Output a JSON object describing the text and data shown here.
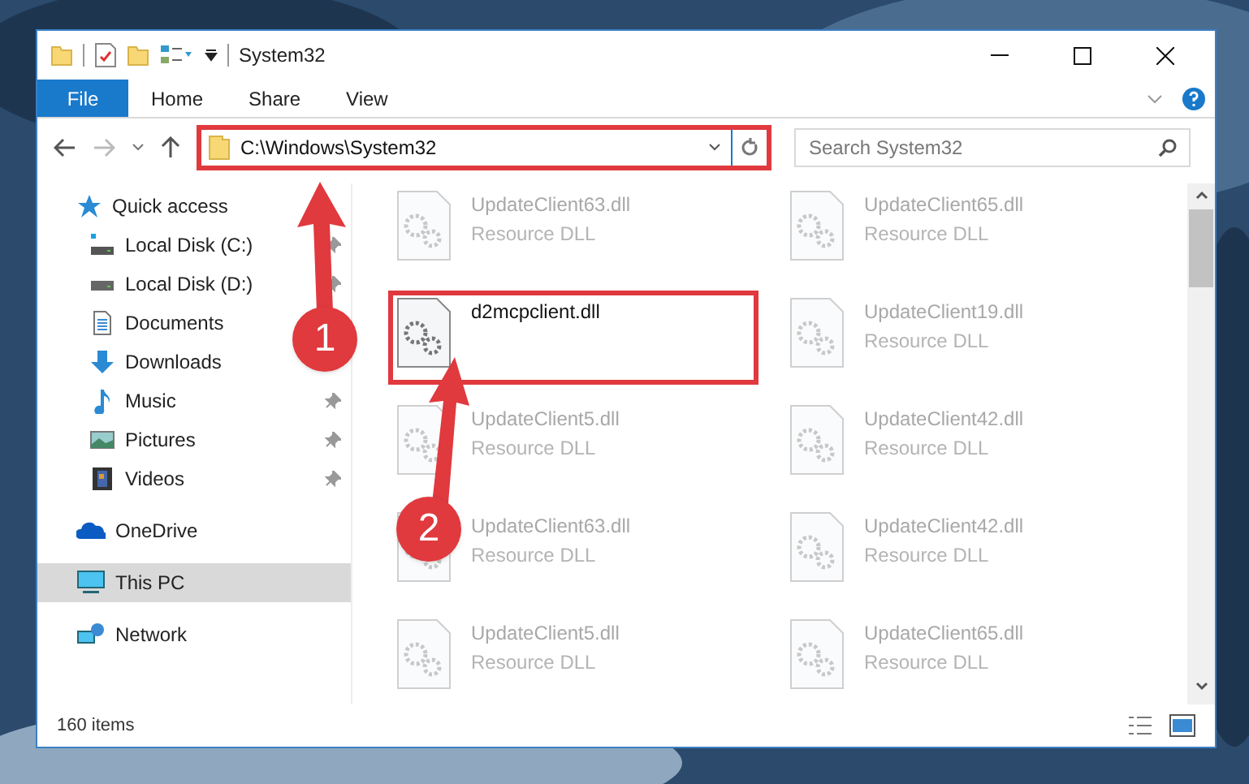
{
  "window": {
    "title": "System32"
  },
  "ribbon_tabs": [
    {
      "label": "File",
      "selected": true
    },
    {
      "label": "Home",
      "selected": false
    },
    {
      "label": "Share",
      "selected": false
    },
    {
      "label": "View",
      "selected": false
    }
  ],
  "address_bar": {
    "path": "C:\\Windows\\System32",
    "highlighted": true
  },
  "search": {
    "placeholder": "Search System32"
  },
  "sidebar": {
    "items": [
      {
        "label": "Quick access",
        "kind": "quick",
        "selected": false,
        "children": [
          {
            "label": "Local Disk (C:)",
            "kind": "diskc",
            "pinned": true
          },
          {
            "label": "Local Disk (D:)",
            "kind": "disk",
            "pinned": true
          },
          {
            "label": "Documents",
            "kind": "documents",
            "pinned": false
          },
          {
            "label": "Downloads",
            "kind": "downloads",
            "pinned": false
          },
          {
            "label": "Music",
            "kind": "music",
            "pinned": true
          },
          {
            "label": "Pictures",
            "kind": "pictures",
            "pinned": true
          },
          {
            "label": "Videos",
            "kind": "videos",
            "pinned": true
          }
        ]
      },
      {
        "label": "OneDrive",
        "kind": "onedrive",
        "selected": false
      },
      {
        "label": "This PC",
        "kind": "pc",
        "selected": true
      },
      {
        "label": "Network",
        "kind": "network",
        "selected": false
      }
    ]
  },
  "files": [
    {
      "name": "UpdateClient63.dll",
      "type": "Resource DLL",
      "highlighted": false
    },
    {
      "name": "UpdateClient65.dll",
      "type": "Resource DLL",
      "highlighted": false
    },
    {
      "name": "d2mcpclient.dll",
      "highlighted": true
    },
    {
      "name": "UpdateClient19.dll",
      "type": "Resource DLL",
      "highlighted": false
    },
    {
      "name": "UpdateClient5.dll",
      "type": "Resource DLL",
      "highlighted": false
    },
    {
      "name": "UpdateClient42.dll",
      "type": "Resource DLL",
      "highlighted": false
    },
    {
      "name": "UpdateClient63.dll",
      "type": "Resource DLL",
      "highlighted": false
    },
    {
      "name": "UpdateClient42.dll",
      "type": "Resource DLL",
      "highlighted": false
    },
    {
      "name": "UpdateClient5.dll",
      "type": "Resource DLL",
      "highlighted": false
    },
    {
      "name": "UpdateClient65.dll",
      "type": "Resource DLL",
      "highlighted": false
    }
  ],
  "status_bar": {
    "count": "160 items"
  },
  "annotations": [
    {
      "label": "1"
    },
    {
      "label": "2"
    }
  ]
}
